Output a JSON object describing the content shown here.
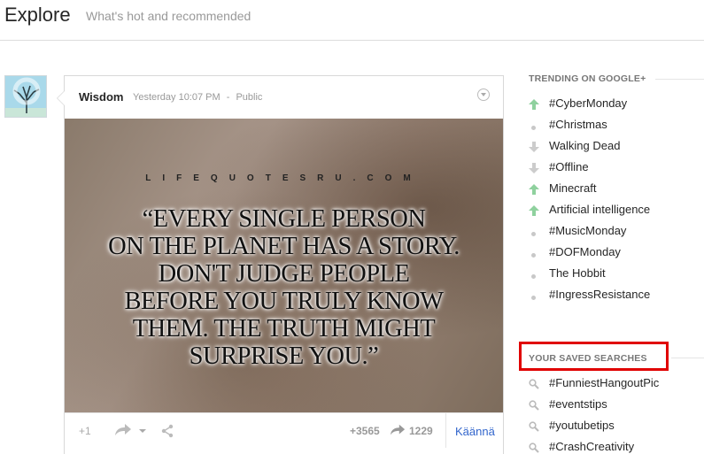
{
  "header": {
    "title": "Explore",
    "subtitle": "What's hot and recommended"
  },
  "post": {
    "author": "Wisdom",
    "time": "Yesterday 10:07 PM",
    "separator": "-",
    "visibility": "Public",
    "image": {
      "site": "LIFEQUOTESRU.COM",
      "quote_lines": [
        "“EVERY SINGLE PERSON",
        "ON THE PLANET HAS A STORY.",
        "DON'T JUDGE PEOPLE",
        "BEFORE YOU TRULY KNOW",
        "THEM. THE TRUTH MIGHT",
        "SURPRISE YOU.”"
      ]
    },
    "actions": {
      "plus_one": "+1",
      "plus_count": "+3565",
      "reshare_count": "1229",
      "translate": "Käännä"
    }
  },
  "trending": {
    "heading": "TRENDING ON GOOGLE+",
    "items": [
      {
        "label": "#CyberMonday",
        "trend": "up"
      },
      {
        "label": "#Christmas",
        "trend": "same"
      },
      {
        "label": "Walking Dead",
        "trend": "down"
      },
      {
        "label": "#Offline",
        "trend": "down"
      },
      {
        "label": "Minecraft",
        "trend": "up"
      },
      {
        "label": "Artificial intelligence",
        "trend": "up"
      },
      {
        "label": "#MusicMonday",
        "trend": "same"
      },
      {
        "label": "#DOFMonday",
        "trend": "same"
      },
      {
        "label": "The Hobbit",
        "trend": "same"
      },
      {
        "label": "#IngressResistance",
        "trend": "same"
      }
    ]
  },
  "saved": {
    "heading": "YOUR SAVED SEARCHES",
    "items": [
      "#FunniestHangoutPic",
      "#eventstips",
      "#youtubetips",
      "#CrashCreativity"
    ]
  },
  "colors": {
    "up": "#8fd19e",
    "down": "#cccccc",
    "highlight": "#e00000",
    "link": "#3366cc"
  }
}
